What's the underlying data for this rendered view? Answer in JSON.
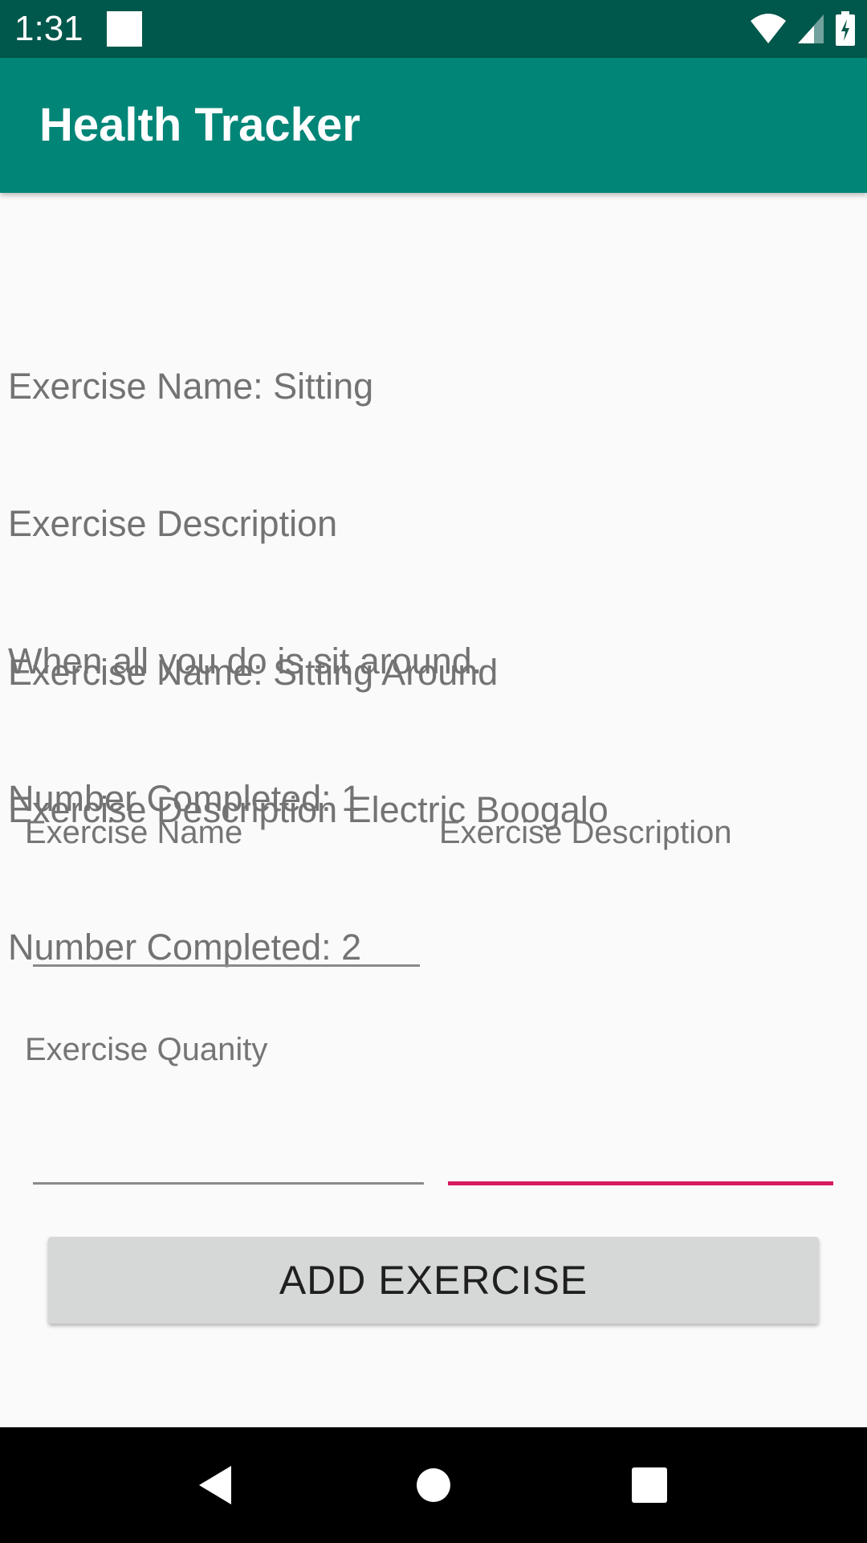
{
  "status_bar": {
    "time": "1:31",
    "icons": [
      "notification-square-icon",
      "wifi-icon",
      "signal-icon",
      "battery-charging-icon"
    ]
  },
  "app_bar": {
    "title": "Health Tracker"
  },
  "exercises": [
    {
      "lines": [
        "Exercise Name: Sitting",
        "Exercise Description",
        "When all you do is sit around.",
        "Number Completed: 1"
      ]
    },
    {
      "lines": [
        "Exercise Name: Sitting Around",
        "Exercise Description Electric Boogalo",
        "Number Completed: 2"
      ]
    }
  ],
  "form": {
    "name_label": "Exercise Name",
    "description_label": "Exercise Description",
    "quantity_label": "Exercise Quanity",
    "name_value": "",
    "description_value": "",
    "quantity_value": "",
    "add_button_label": "ADD EXERCISE"
  },
  "nav_bar": {
    "buttons": [
      "back-icon",
      "home-icon",
      "recents-icon"
    ]
  },
  "colors": {
    "status_bar": "#00574b",
    "app_bar": "#008577",
    "accent": "#d81b60",
    "text_secondary": "#737373"
  }
}
